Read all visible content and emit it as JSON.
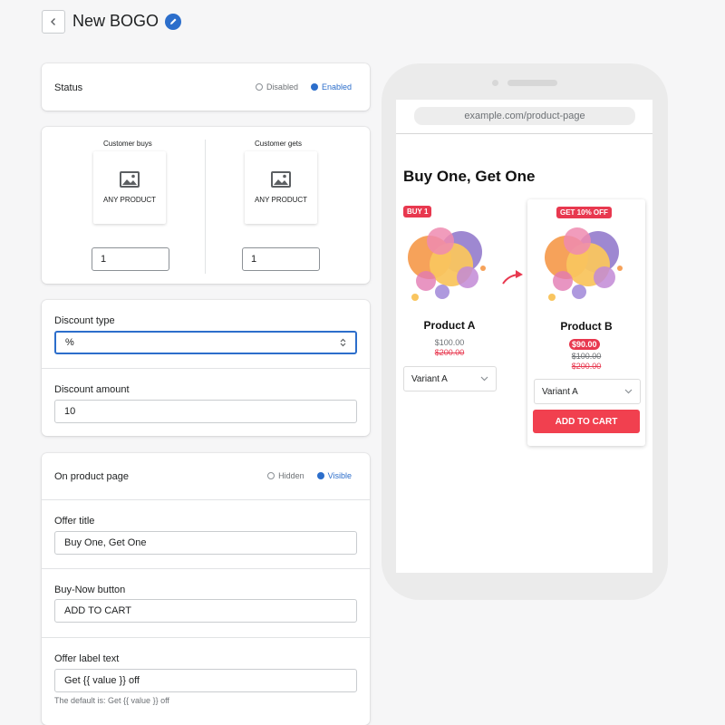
{
  "header": {
    "title": "New BOGO"
  },
  "status": {
    "label": "Status",
    "options": [
      {
        "label": "Disabled",
        "selected": false
      },
      {
        "label": "Enabled",
        "selected": true
      }
    ]
  },
  "products": {
    "buys": {
      "caption": "Customer buys",
      "product": "ANY PRODUCT",
      "qty": "1"
    },
    "gets": {
      "caption": "Customer gets",
      "product": "ANY PRODUCT",
      "qty": "1"
    }
  },
  "discount": {
    "type_label": "Discount type",
    "type_value": "%",
    "amount_label": "Discount amount",
    "amount_value": "10"
  },
  "product_page": {
    "label": "On product page",
    "options": [
      {
        "label": "Hidden",
        "selected": false
      },
      {
        "label": "Visible",
        "selected": true
      }
    ],
    "offer_title_label": "Offer title",
    "offer_title_value": "Buy One, Get One",
    "buy_now_label": "Buy-Now button",
    "buy_now_value": "ADD TO CART",
    "offer_label_label": "Offer label text",
    "offer_label_value": "Get {{ value }} off",
    "offer_label_help": "The default is: Get {{ value }} off"
  },
  "preview": {
    "url": "example.com/product-page",
    "title": "Buy One, Get One",
    "product_a": {
      "badge": "BUY 1",
      "name": "Product A",
      "price": "$100.00",
      "compare": "$200.00",
      "variant": "Variant A"
    },
    "product_b": {
      "badge": "GET 10% OFF",
      "name": "Product B",
      "price": "$90.00",
      "compare1": "$100.00",
      "compare2": "$200.00",
      "variant": "Variant A",
      "button": "ADD TO CART"
    }
  },
  "colors": {
    "accent": "#2c6ecb",
    "sale": "#e8384f",
    "cart": "#f1404f"
  }
}
